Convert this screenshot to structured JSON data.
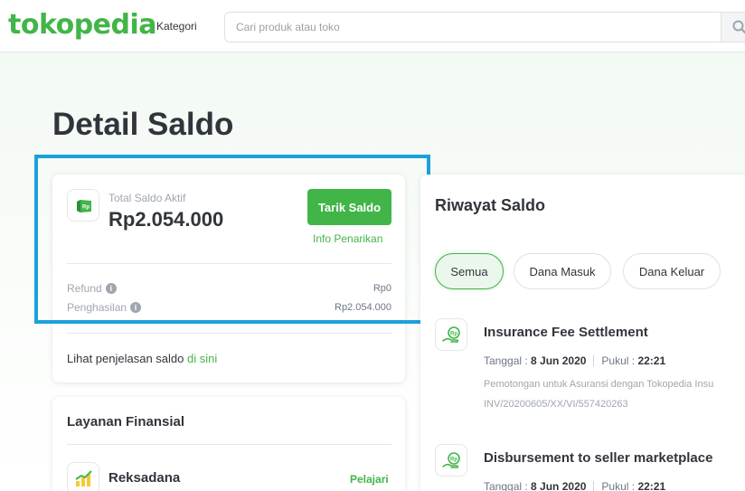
{
  "header": {
    "logo": "tokopedia",
    "kategori_label": "Kategori",
    "search_placeholder": "Cari produk atau toko"
  },
  "page_title": "Detail Saldo",
  "saldo_card": {
    "total_label": "Total Saldo Aktif",
    "total_value": "Rp2.054.000",
    "wallet_icon_text": "Rp",
    "tarik_button": "Tarik Saldo",
    "info_penarikan": "Info Penarikan",
    "rows": [
      {
        "label": "Refund",
        "value": "Rp0"
      },
      {
        "label": "Penghasilan",
        "value": "Rp2.054.000"
      }
    ],
    "penjelasan_text": "Lihat penjelasan saldo ",
    "penjelasan_link": "di sini"
  },
  "layanan_card": {
    "title": "Layanan Finansial",
    "items": [
      {
        "name": "Reksadana",
        "action": "Pelajari"
      }
    ]
  },
  "riwayat": {
    "title": "Riwayat Saldo",
    "tabs": [
      {
        "label": "Semua",
        "active": true
      },
      {
        "label": "Dana Masuk",
        "active": false
      },
      {
        "label": "Dana Keluar",
        "active": false
      }
    ],
    "transactions": [
      {
        "title": "Insurance Fee Settlement",
        "tanggal_label": "Tanggal : ",
        "tanggal": "8 Jun 2020",
        "pukul_label": "Pukul : ",
        "pukul": "22:21",
        "desc_line1": "Pemotongan untuk Asuransi dengan Tokopedia Insu",
        "desc_line2": "INV/20200605/XX/VI/557420263"
      },
      {
        "title": "Disbursement to seller marketplace",
        "tanggal_label": "Tanggal : ",
        "tanggal": "8 Jun 2020",
        "pukul_label": "Pukul : ",
        "pukul": "22:21"
      }
    ]
  },
  "colors": {
    "brand_green": "#42b549",
    "highlight_blue": "#1aa1dc",
    "text_dark": "#31353b",
    "text_muted": "#9fa6b0"
  },
  "icons": [
    "search-icon",
    "wallet-icon",
    "info-icon",
    "chart-icon",
    "money-hand-icon"
  ]
}
